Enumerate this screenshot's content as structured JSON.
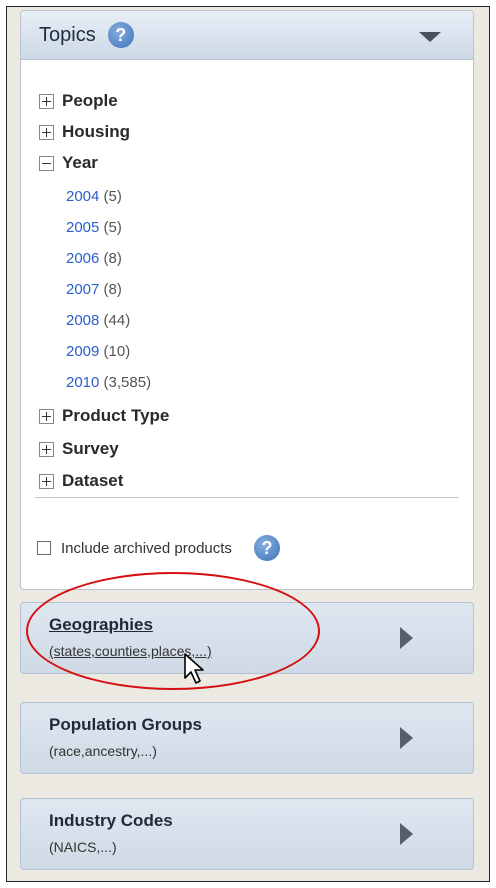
{
  "topics": {
    "title": "Topics",
    "categories": [
      {
        "label": "People",
        "expanded": false
      },
      {
        "label": "Housing",
        "expanded": false
      },
      {
        "label": "Year",
        "expanded": true
      },
      {
        "label": "Product Type",
        "expanded": false
      },
      {
        "label": "Survey",
        "expanded": false
      },
      {
        "label": "Dataset",
        "expanded": false
      }
    ],
    "years": [
      {
        "year": "2004",
        "count": "(5)"
      },
      {
        "year": "2005",
        "count": "(5)"
      },
      {
        "year": "2006",
        "count": "(8)"
      },
      {
        "year": "2007",
        "count": "(8)"
      },
      {
        "year": "2008",
        "count": "(44)"
      },
      {
        "year": "2009",
        "count": "(10)"
      },
      {
        "year": "2010",
        "count": "(3,585)"
      }
    ],
    "archive_label": "Include archived products",
    "archive_checked": false
  },
  "panels": [
    {
      "title": "Geographies",
      "subtitle": "(states,counties,places,...)"
    },
    {
      "title": "Population Groups",
      "subtitle": "(race,ancestry,...)"
    },
    {
      "title": "Industry Codes",
      "subtitle": "(NAICS,...)"
    }
  ],
  "icons": {
    "help": "help-icon",
    "collapse": "chevron-down-icon",
    "expand_panel": "chevron-right-icon",
    "cursor": "mouse-pointer-icon"
  },
  "colors": {
    "link": "#2a5ec9",
    "highlight": "#d41010",
    "panel_header": "#cdd9e6"
  }
}
